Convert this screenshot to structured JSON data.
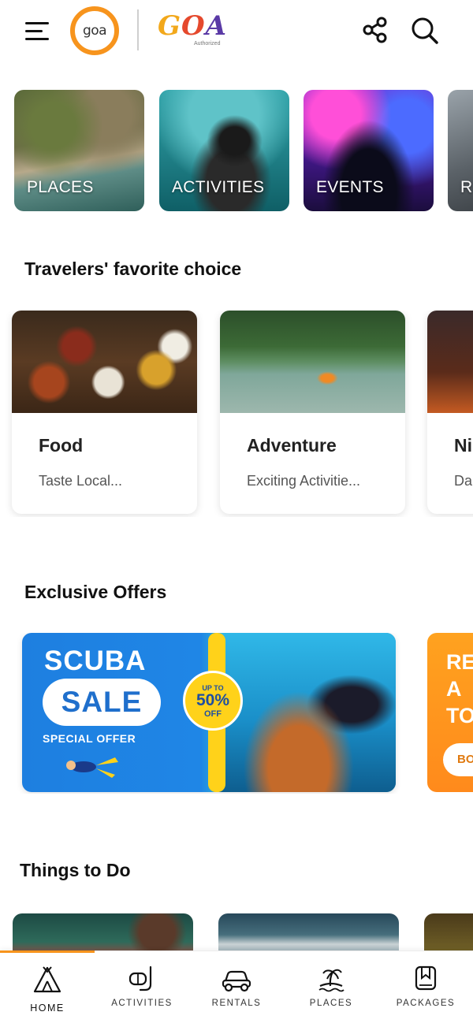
{
  "header": {
    "logo_text": "goa",
    "brand_text": "GOA",
    "brand_sub": "Authorized",
    "menu_icon": "hamburger-menu-icon",
    "share_icon": "share-icon",
    "search_icon": "search-icon",
    "accent_color": "#f7941d"
  },
  "categories": [
    {
      "label": "PLACES"
    },
    {
      "label": "ACTIVITIES"
    },
    {
      "label": "EVENTS"
    },
    {
      "label": "R"
    }
  ],
  "favorites": {
    "title": "Travelers' favorite choice",
    "cards": [
      {
        "title": "Food",
        "desc": "Taste Local..."
      },
      {
        "title": "Adventure",
        "desc": "Exciting Activitie..."
      },
      {
        "title": "Ni",
        "desc": "Da"
      }
    ]
  },
  "offers": {
    "title": "Exclusive Offers",
    "scuba": {
      "line1": "SCUBA",
      "line2": "SALE",
      "line3": "SPECIAL OFFER",
      "badge_top": "UP TO",
      "badge_main": "50%",
      "badge_bottom": "OFF"
    },
    "second": {
      "text_lines": [
        "RE",
        "A",
        "TO"
      ],
      "button": "BO"
    }
  },
  "things": {
    "title": "Things to Do"
  },
  "bottom_nav": [
    {
      "label": "HOME",
      "icon": "tent-icon"
    },
    {
      "label": "ACTIVITIES",
      "icon": "snorkel-icon"
    },
    {
      "label": "RENTALS",
      "icon": "car-icon"
    },
    {
      "label": "PLACES",
      "icon": "palm-island-icon"
    },
    {
      "label": "PACKAGES",
      "icon": "bookmark-book-icon"
    }
  ]
}
